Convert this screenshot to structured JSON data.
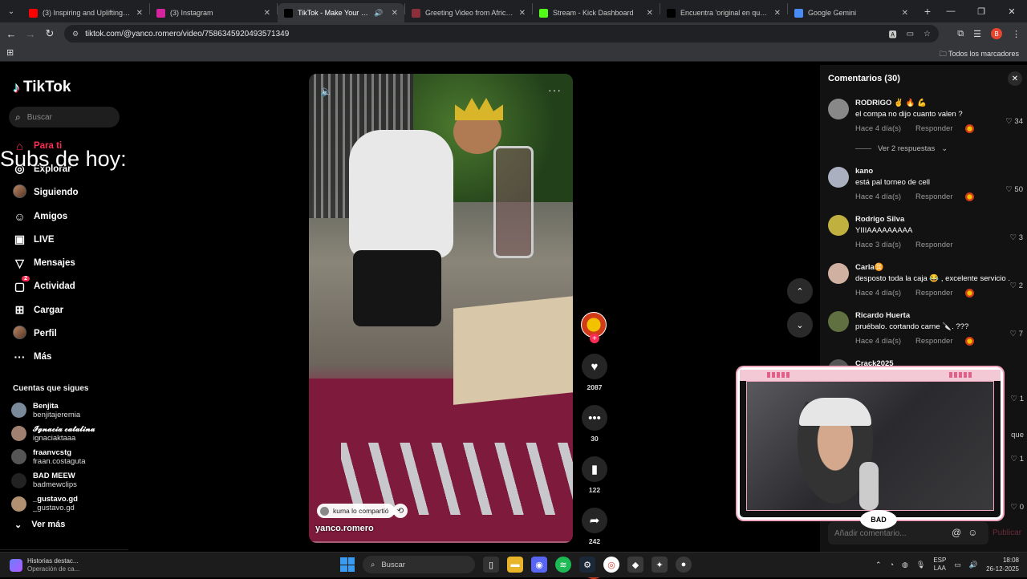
{
  "browser": {
    "tabs": [
      {
        "label": "(3) Inspiring and Uplifting Backg",
        "color": "#ff0000",
        "active": false
      },
      {
        "label": "(3) Instagram",
        "color": "#d6249f",
        "active": false
      },
      {
        "label": "TikTok - Make Your Day",
        "color": "#000000",
        "active": true
      },
      {
        "label": "Greeting Video from Africa – d",
        "color": "#8b2f3a",
        "active": false
      },
      {
        "label": "Stream - Kick Dashboard",
        "color": "#53fc18",
        "active": false
      },
      {
        "label": "Encuentra 'original en que asp",
        "color": "#000000",
        "active": false
      },
      {
        "label": "Google Gemini",
        "color": "#4a8cf7",
        "active": false
      }
    ],
    "url": "tiktok.com/@yanco.romero/video/7586345920493571349",
    "bookmarks_all": "Todos los marcadores",
    "profile_initial": "B"
  },
  "tiktok": {
    "logo": "TikTok",
    "search_placeholder": "Buscar",
    "menu": [
      {
        "label": "Para ti",
        "icon": "home-icon",
        "active": true
      },
      {
        "label": "Explorar",
        "icon": "compass-icon",
        "active": false
      },
      {
        "label": "Siguiendo",
        "icon": "following-avatar-icon",
        "active": false
      },
      {
        "label": "Amigos",
        "icon": "friends-icon",
        "active": false
      },
      {
        "label": "LIVE",
        "icon": "live-icon",
        "active": false
      },
      {
        "label": "Mensajes",
        "icon": "messages-icon",
        "active": false
      },
      {
        "label": "Actividad",
        "icon": "activity-icon",
        "active": false,
        "badge": "2"
      },
      {
        "label": "Cargar",
        "icon": "upload-icon",
        "active": false
      },
      {
        "label": "Perfil",
        "icon": "profile-avatar-icon",
        "active": false
      },
      {
        "label": "Más",
        "icon": "more-icon",
        "active": false
      }
    ],
    "overlay_text": "Subs de hoy:",
    "following_title": "Cuentas que sigues",
    "following": [
      {
        "name": "Benjita",
        "user": "benjitajeremia",
        "color": "#7a8a9a"
      },
      {
        "name": "𝓘𝓰𝓷𝓪𝓬𝓲𝓪 𝓬𝓪𝓽𝓪𝓵𝓲𝓷𝓪",
        "user": "ignaciaktaaa",
        "color": "#a08070"
      },
      {
        "name": "fraanvcstg",
        "user": "fraan.costaguta",
        "color": "#555555"
      },
      {
        "name": "BAD MEEW",
        "user": "badmewclips",
        "color": "#222222"
      },
      {
        "name": "_gustavo.gd",
        "user": "_gustavo.gd",
        "color": "#b09070"
      }
    ],
    "ver_mas": "Ver más",
    "video": {
      "shared_by": "kuma lo compartió",
      "username": "yanco.romero"
    },
    "actions": {
      "likes": "2087",
      "comments": "30",
      "saves": "122",
      "shares": "242"
    },
    "comments_panel": {
      "title": "Comentarios (30)",
      "view_replies": "Ver 2 respuestas",
      "input_placeholder": "Añadir comentario...",
      "publish": "Publicar",
      "items": [
        {
          "name": "RODRIGO ✌️ 🔥 💪",
          "text": "el compa no dijo cuanto valen ?",
          "time": "Hace 4 día(s)",
          "reply": "Responder",
          "likes": "34",
          "creator_liked": true,
          "color": "#888888"
        },
        {
          "name": "kano",
          "text": "está pal torneo de cell",
          "time": "Hace 4 día(s)",
          "reply": "Responder",
          "likes": "50",
          "creator_liked": true,
          "color": "#aab0c0"
        },
        {
          "name": "Rodrigo Silva",
          "text": "YIIIAAAAAAAAA",
          "time": "Hace 3 día(s)",
          "reply": "Responder",
          "likes": "3",
          "creator_liked": false,
          "color": "#c0b040"
        },
        {
          "name": "Carla♊",
          "text": "desposto toda la caja 😂 , excelente servicio .",
          "time": "Hace 4 día(s)",
          "reply": "Responder",
          "likes": "2",
          "creator_liked": true,
          "color": "#d0b0a0"
        },
        {
          "name": "Ricardo Huerta",
          "text": "pruébalo. cortando carne 🔪. ???",
          "time": "Hace 4 día(s)",
          "reply": "Responder",
          "likes": "7",
          "creator_liked": true,
          "color": "#607040"
        },
        {
          "name": "Crack2025",
          "text": "",
          "time": "",
          "reply": "",
          "likes": "1",
          "creator_liked": false,
          "color": "#555555"
        }
      ],
      "hidden_likes": [
        "1",
        "1",
        "0"
      ],
      "partial_text": "que"
    },
    "webcam_logo": "BAD"
  },
  "taskbar": {
    "news_title": "Historias destac...",
    "news_sub": "Operación de ca...",
    "search": "Buscar",
    "lang_top": "ESP",
    "lang_bottom": "LAA",
    "time": "18:08",
    "date": "26-12-2025"
  }
}
